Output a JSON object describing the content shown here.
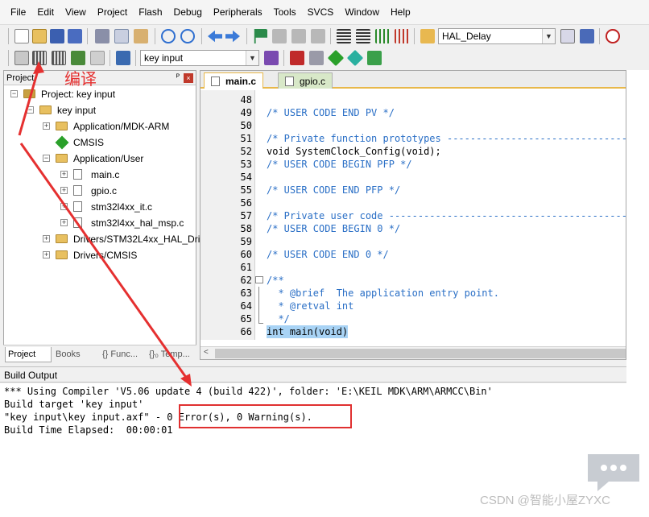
{
  "menu": [
    "File",
    "Edit",
    "View",
    "Project",
    "Flash",
    "Debug",
    "Peripherals",
    "Tools",
    "SVCS",
    "Window",
    "Help"
  ],
  "toolbar": {
    "function_combo": "HAL_Delay",
    "target_combo": "key input"
  },
  "project_panel": {
    "title": "Project",
    "pin_symbol": "ᴾ",
    "close_symbol": "×",
    "tree": [
      {
        "label": "Project: key input",
        "level": 0,
        "kind": "project"
      },
      {
        "label": "key input",
        "level": 1,
        "kind": "target"
      },
      {
        "label": "Application/MDK-ARM",
        "level": 2,
        "kind": "folder"
      },
      {
        "label": "CMSIS",
        "level": 2,
        "kind": "gem"
      },
      {
        "label": "Application/User",
        "level": 2,
        "kind": "folder"
      },
      {
        "label": "main.c",
        "level": 3,
        "kind": "file"
      },
      {
        "label": "gpio.c",
        "level": 3,
        "kind": "file"
      },
      {
        "label": "stm32l4xx_it.c",
        "level": 3,
        "kind": "file"
      },
      {
        "label": "stm32l4xx_hal_msp.c",
        "level": 3,
        "kind": "file"
      },
      {
        "label": "Drivers/STM32L4xx_HAL_Driv",
        "level": 2,
        "kind": "folder"
      },
      {
        "label": "Drivers/CMSIS",
        "level": 2,
        "kind": "folder"
      }
    ],
    "tabs": [
      "Project",
      "Books",
      "{} Func...",
      "{}₀ Temp..."
    ]
  },
  "editor": {
    "tabs": [
      "main.c",
      "gpio.c"
    ],
    "lines": [
      {
        "n": "48",
        "t": ""
      },
      {
        "n": "49",
        "t": "/* USER CODE END PV */",
        "c": "comment"
      },
      {
        "n": "50",
        "t": ""
      },
      {
        "n": "51",
        "t": "/* Private function prototypes -----------------------------------------------",
        "c": "comment"
      },
      {
        "n": "52",
        "t": "void SystemClock_Config(void);",
        "c": "code"
      },
      {
        "n": "53",
        "t": "/* USER CODE BEGIN PFP */",
        "c": "comment"
      },
      {
        "n": "54",
        "t": ""
      },
      {
        "n": "55",
        "t": "/* USER CODE END PFP */",
        "c": "comment"
      },
      {
        "n": "56",
        "t": ""
      },
      {
        "n": "57",
        "t": "/* Private user code ---------------------------------------------------------",
        "c": "comment"
      },
      {
        "n": "58",
        "t": "/* USER CODE BEGIN 0 */",
        "c": "comment"
      },
      {
        "n": "59",
        "t": ""
      },
      {
        "n": "60",
        "t": "/* USER CODE END 0 */",
        "c": "comment"
      },
      {
        "n": "61",
        "t": ""
      },
      {
        "n": "62",
        "t": "/**",
        "c": "comment"
      },
      {
        "n": "63",
        "t": "  * @brief  The application entry point.",
        "c": "comment"
      },
      {
        "n": "64",
        "t": "  * @retval int",
        "c": "comment"
      },
      {
        "n": "65",
        "t": "  */",
        "c": "comment"
      },
      {
        "n": "66",
        "t": "int main(void)",
        "c": "highlight"
      }
    ]
  },
  "build": {
    "title": "Build Output",
    "lines": [
      "*** Using Compiler 'V5.06 update 4 (build 422)', folder: 'E:\\KEIL MDK\\ARM\\ARMCC\\Bin'",
      "Build target 'key input'",
      "\"key input\\key input.axf\" - 0 Error(s), 0 Warning(s).",
      "Build Time Elapsed:  00:00:01"
    ]
  },
  "annotation": "编译",
  "watermark": "CSDN @智能小屋ZYXC",
  "colors": {
    "comment": "#2a6fc6",
    "highlight": "#a8d3f5",
    "annotation": "#e53030",
    "tab_accent": "#e8b84a"
  }
}
